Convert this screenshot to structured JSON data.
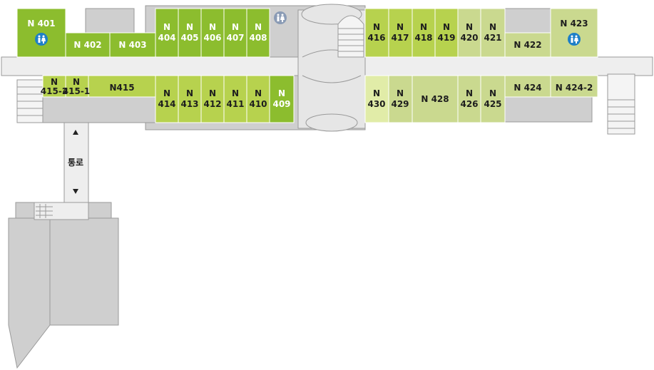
{
  "colors": {
    "dark_green": "#8cbd2e",
    "mid_green": "#b7d24e",
    "light_green": "#cad98f",
    "pale_green": "#e1eca8",
    "structure_gray": "#cfcfcf",
    "corridor": "#eeeeee",
    "restroom_blue": "#1e7fc8"
  },
  "corridor_label": "통로",
  "rooms": {
    "n401": "N 401",
    "n402": "N 402",
    "n403": "N 403",
    "n404": [
      "N",
      "404"
    ],
    "n405": [
      "N",
      "405"
    ],
    "n406": [
      "N",
      "406"
    ],
    "n407": [
      "N",
      "407"
    ],
    "n408": [
      "N",
      "408"
    ],
    "n409": [
      "N",
      "409"
    ],
    "n410": [
      "N",
      "410"
    ],
    "n411": [
      "N",
      "411"
    ],
    "n412": [
      "N",
      "412"
    ],
    "n413": [
      "N",
      "413"
    ],
    "n414": [
      "N",
      "414"
    ],
    "n415": "N415",
    "n415_1": [
      "N",
      "415-1"
    ],
    "n415_2": [
      "N",
      "415-2"
    ],
    "n416": [
      "N",
      "416"
    ],
    "n417": [
      "N",
      "417"
    ],
    "n418": [
      "N",
      "418"
    ],
    "n419": [
      "N",
      "419"
    ],
    "n420": [
      "N",
      "420"
    ],
    "n421": [
      "N",
      "421"
    ],
    "n422": "N 422",
    "n423": "N 423",
    "n424": "N 424",
    "n424_2": "N 424-2",
    "n425": [
      "N",
      "425"
    ],
    "n426": [
      "N",
      "426"
    ],
    "n428": "N 428",
    "n429": [
      "N",
      "429"
    ],
    "n430": [
      "N",
      "430"
    ]
  }
}
